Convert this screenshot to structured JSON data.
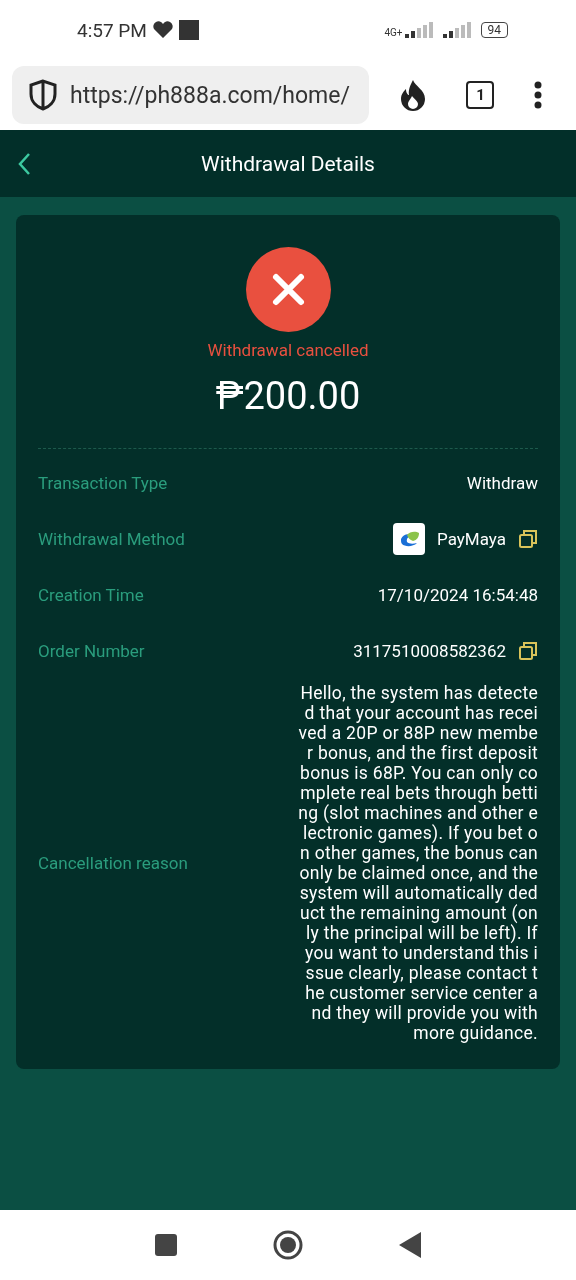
{
  "status_bar": {
    "time": "4:57 PM",
    "network": "4G+",
    "battery": "94"
  },
  "browser": {
    "url": "https://ph888a.com/home/",
    "tab_count": "1"
  },
  "header": {
    "title": "Withdrawal Details"
  },
  "summary": {
    "cancelled": true,
    "status_text": "Withdrawal cancelled",
    "amount": "₱200.00"
  },
  "details": [
    {
      "kind": "text",
      "label": "Transaction Type",
      "value": "Withdraw"
    },
    {
      "kind": "method",
      "label": "Withdrawal Method",
      "value": "PayMaya"
    },
    {
      "kind": "text",
      "label": "Creation Time",
      "value": "17/10/2024 16:54:48"
    },
    {
      "kind": "copy",
      "label": "Order Number",
      "value": "3117510008582362"
    },
    {
      "kind": "paragraph",
      "label": "Cancellation reason",
      "value": "Hello, the system has detected that your account has received a 20P or 88P new member bonus, and the first deposit bonus is 68P. You can only complete real bets through betting (slot machines and other electronic games). If you bet on other games, the bonus can only be claimed once, and the system will automatically deduct the remaining amount (only the principal will be left). If you want to understand this issue clearly, please contact the customer service center and they will provide you with more guidance."
    }
  ]
}
